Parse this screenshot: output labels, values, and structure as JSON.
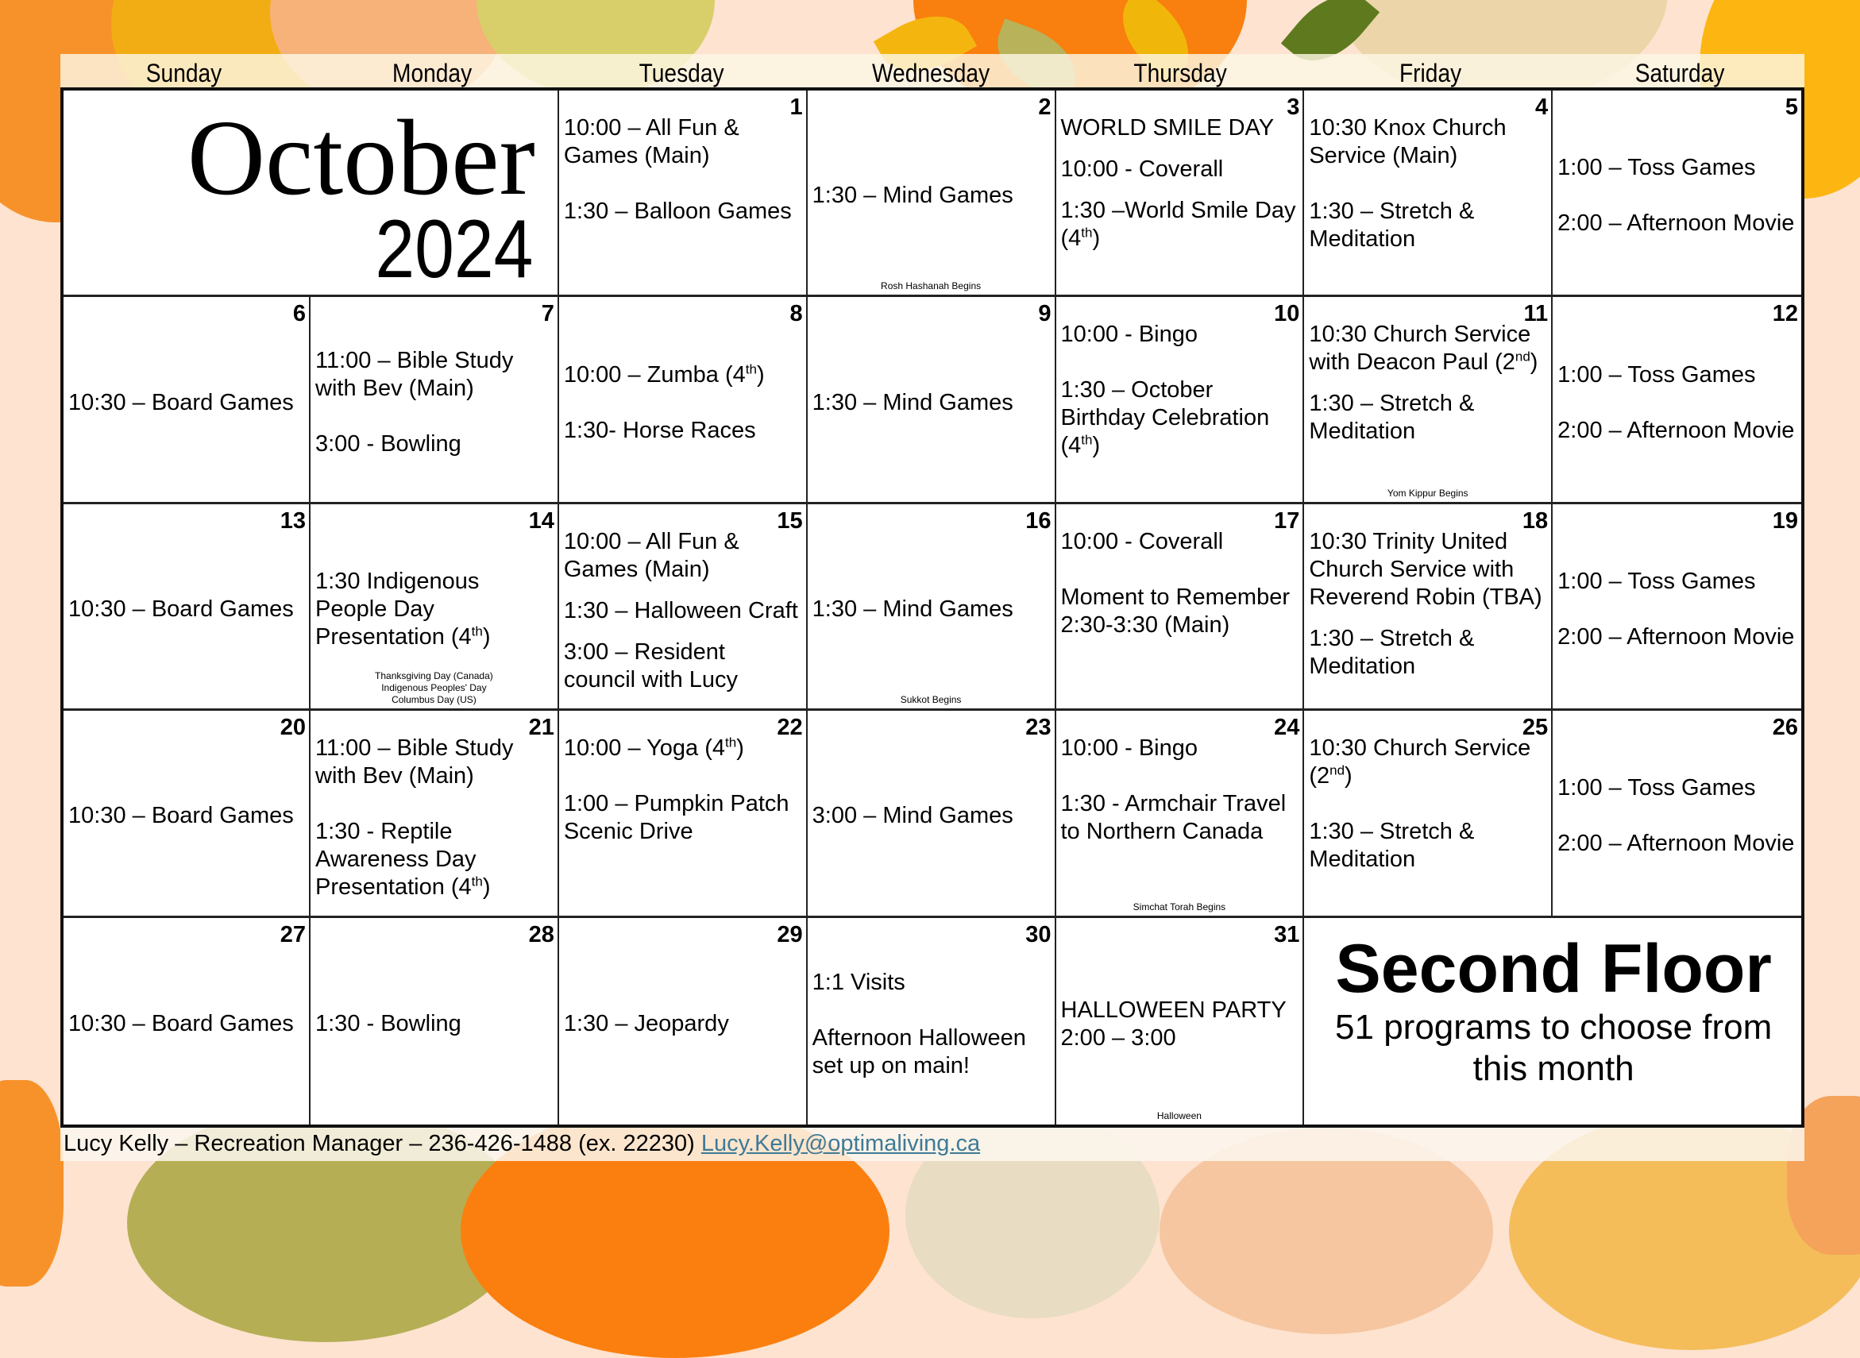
{
  "calendar": {
    "month": "October",
    "year": "2024",
    "day_names": [
      "Sunday",
      "Monday",
      "Tuesday",
      "Wednesday",
      "Thursday",
      "Friday",
      "Saturday"
    ],
    "days": {
      "d1": {
        "num": "1",
        "events": [
          "10:00 – All Fun & Games (Main)",
          "1:30 – Balloon Games"
        ]
      },
      "d2": {
        "num": "2",
        "events": [
          "1:30 – Mind Games"
        ],
        "holiday": "Rosh Hashanah Begins"
      },
      "d3": {
        "num": "3",
        "events": [
          "WORLD SMILE DAY",
          "10:00 - Coverall",
          "1:30 –World Smile Day (4",
          "th",
          ")"
        ]
      },
      "d4": {
        "num": "4",
        "events": [
          "10:30 Knox Church Service (Main)",
          "1:30 – Stretch & Meditation"
        ]
      },
      "d5": {
        "num": "5",
        "events": [
          "1:00 – Toss Games",
          "2:00 – Afternoon Movie"
        ]
      },
      "d6": {
        "num": "6",
        "events": [
          "10:30 – Board Games"
        ]
      },
      "d7": {
        "num": "7",
        "events": [
          "11:00 – Bible Study with Bev (Main)",
          "3:00 - Bowling"
        ]
      },
      "d8": {
        "num": "8",
        "events": [
          "10:00 – Zumba (4",
          "th",
          ")",
          "1:30- Horse Races"
        ]
      },
      "d9": {
        "num": "9",
        "events": [
          "1:30 – Mind Games"
        ]
      },
      "d10": {
        "num": "10",
        "events": [
          "10:00 - Bingo",
          "1:30 – October Birthday Celebration (4",
          "th",
          ")"
        ]
      },
      "d11": {
        "num": "11",
        "events": [
          "10:30 Church Service with Deacon Paul (2",
          "nd",
          ")",
          "1:30 – Stretch & Meditation"
        ],
        "holiday": "Yom Kippur Begins"
      },
      "d12": {
        "num": "12",
        "events": [
          "1:00 – Toss Games",
          "2:00 – Afternoon Movie"
        ]
      },
      "d13": {
        "num": "13",
        "events": [
          "10:30 – Board Games"
        ]
      },
      "d14": {
        "num": "14",
        "events": [
          "1:30 Indigenous People Day Presentation (4",
          "th",
          ")"
        ],
        "holiday": "Thanksgiving Day (Canada)\nIndigenous Peoples' Day\nColumbus Day (US)"
      },
      "d15": {
        "num": "15",
        "events": [
          "10:00 – All Fun & Games (Main)",
          "1:30 – Halloween Craft",
          "3:00 – Resident council with Lucy"
        ]
      },
      "d16": {
        "num": "16",
        "events": [
          "1:30 – Mind Games"
        ],
        "holiday": "Sukkot Begins"
      },
      "d17": {
        "num": "17",
        "events": [
          "10:00 - Coverall",
          "Moment to Remember 2:30-3:30 (Main)"
        ]
      },
      "d18": {
        "num": "18",
        "events": [
          "10:30 Trinity United Church Service with Reverend Robin (TBA)",
          "1:30 – Stretch & Meditation"
        ]
      },
      "d19": {
        "num": "19",
        "events": [
          "1:00 – Toss Games",
          "2:00 – Afternoon Movie"
        ]
      },
      "d20": {
        "num": "20",
        "events": [
          "10:30 – Board Games"
        ]
      },
      "d21": {
        "num": "21",
        "events": [
          "11:00 – Bible Study with Bev (Main)",
          "1:30 - Reptile Awareness Day Presentation (4",
          "th",
          ")"
        ]
      },
      "d22": {
        "num": "22",
        "events": [
          "10:00 – Yoga (4",
          "th",
          ")",
          "1:00 – Pumpkin Patch Scenic Drive"
        ]
      },
      "d23": {
        "num": "23",
        "events": [
          "3:00 – Mind Games"
        ]
      },
      "d24": {
        "num": "24",
        "events": [
          "10:00 - Bingo",
          "1:30 - Armchair Travel to Northern Canada"
        ],
        "holiday": "Simchat Torah Begins"
      },
      "d25": {
        "num": "25",
        "events": [
          "10:30 Church Service (2",
          "nd",
          ")",
          "1:30 – Stretch & Meditation"
        ]
      },
      "d26": {
        "num": "26",
        "events": [
          "1:00 – Toss Games",
          "2:00 – Afternoon Movie"
        ]
      },
      "d27": {
        "num": "27",
        "events": [
          "10:30 – Board Games"
        ]
      },
      "d28": {
        "num": "28",
        "events": [
          "1:30 - Bowling"
        ]
      },
      "d29": {
        "num": "29",
        "events": [
          "1:30 – Jeopardy"
        ]
      },
      "d30": {
        "num": "30",
        "events": [
          "1:1 Visits",
          "Afternoon Halloween set up on main!"
        ]
      },
      "d31": {
        "num": "31",
        "events": [
          "HALLOWEEN PARTY 2:00 – 3:00"
        ],
        "holiday": "Halloween"
      }
    }
  },
  "promo": {
    "title": "Second Floor",
    "subtitle": "51 programs to choose from this month"
  },
  "footer": {
    "contact": "Lucy Kelly – Recreation Manager – 236-426-1488 (ex. 22230) ",
    "email": "Lucy.Kelly@optimaliving.ca"
  },
  "colors": {
    "link": "#3f7a97",
    "background": "#fde3d0"
  }
}
